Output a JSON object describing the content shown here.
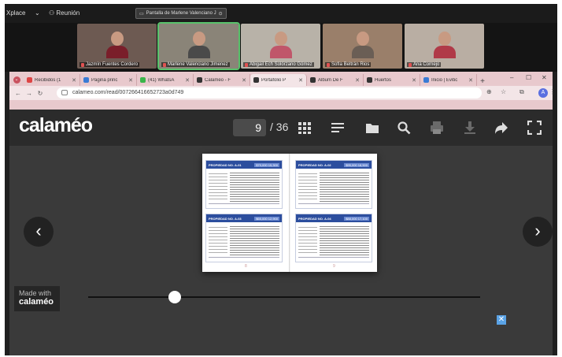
{
  "meeting": {
    "app_label": "Xplace",
    "meeting_label": "Reunión",
    "share_label": "Pantalla de Marlene Valenciano J"
  },
  "participants": [
    {
      "name": "Jazmín Fuentes Cordero",
      "bg": "#6d5a52",
      "shirt": "#7a1e2a",
      "hair": "#2a1a14"
    },
    {
      "name": "Marlene Valenciano Jimenez",
      "bg": "#8a8478",
      "shirt": "#4a4a4a",
      "hair": "#2a1a14"
    },
    {
      "name": "Abigail Ech Solórzano Gómez",
      "bg": "#b8b2a8",
      "shirt": "#c0566a",
      "hair": "#3a2418"
    },
    {
      "name": "Sofía Beltrán Rios",
      "bg": "#9a7f6a",
      "shirt": "#6a5e55",
      "hair": "#4a2a18"
    },
    {
      "name": "Ana Cornejo",
      "bg": "#b9aea3",
      "shirt": "#b03a48",
      "hair": "#2a1a14"
    }
  ],
  "browser": {
    "tabs": [
      {
        "label": "Recibidos (1",
        "color": "#d44"
      },
      {
        "label": "Página princ",
        "color": "#3a7bd5"
      },
      {
        "label": "(41) WhatsA",
        "color": "#3ab54a"
      },
      {
        "label": "Calaméo - F",
        "color": "#333"
      },
      {
        "label": "Portafolio P",
        "color": "#333"
      },
      {
        "label": "Álbum De F",
        "color": "#333"
      },
      {
        "label": "Huertos",
        "color": "#333"
      },
      {
        "label": "Inicio | Evitic",
        "color": "#3a7bd5"
      }
    ],
    "active_tab": 4,
    "url": "calameo.com/read/007266416652723a0d749"
  },
  "calameo": {
    "logo": "calaméo",
    "current_page": "9",
    "total_pages": "/ 36",
    "made_with": "Made with",
    "made_with_brand": "calaméo"
  },
  "book": {
    "pages": [
      {
        "title": "PROPIEDAD NO. A-01",
        "tag": "$79,000  15,300"
      },
      {
        "title": "PROPIEDAD NO. A-02",
        "tag": "$95,000  18,500"
      },
      {
        "title": "PROPIEDAD NO. A-03",
        "tag": "$65,000  12,900"
      },
      {
        "title": "PROPIEDAD NO. A-04",
        "tag": "$88,000  17,100"
      }
    ],
    "page_left": "8",
    "page_right": "9"
  },
  "icons": [
    "grid-icon",
    "list-icon",
    "folder-icon",
    "search-icon",
    "print-icon",
    "download-icon",
    "share-icon",
    "fullscreen-icon"
  ]
}
